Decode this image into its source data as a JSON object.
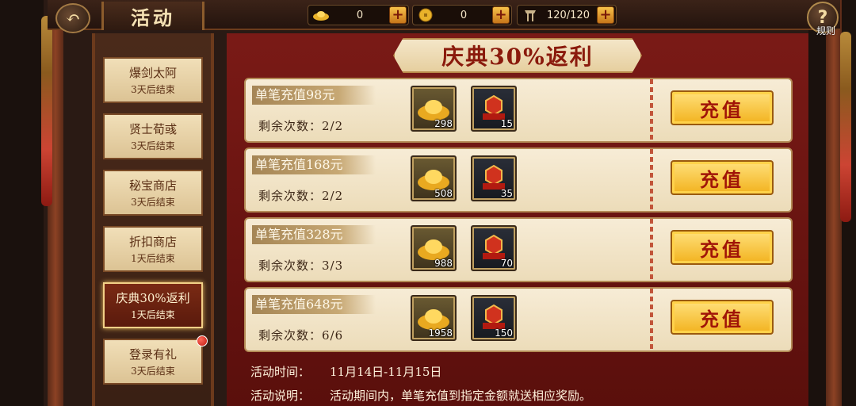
{
  "header": {
    "title": "活动",
    "back_icon": "back-arrow-icon",
    "help_label": "规则",
    "help_symbol": "?"
  },
  "resources": [
    {
      "icon": "gold-ingot-icon",
      "value": "0"
    },
    {
      "icon": "coin-icon",
      "value": "0"
    },
    {
      "icon": "stamina-flag-icon",
      "value": "120/120"
    }
  ],
  "plus_symbol": "+",
  "menu": [
    {
      "name": "爆剑太阿",
      "sub": "3天后结束",
      "active": false,
      "badge": false
    },
    {
      "name": "贤士荀彧",
      "sub": "3天后结束",
      "active": false,
      "badge": false
    },
    {
      "name": "秘宝商店",
      "sub": "3天后结束",
      "active": false,
      "badge": false
    },
    {
      "name": "折扣商店",
      "sub": "1天后结束",
      "active": false,
      "badge": false
    },
    {
      "name": "庆典30%返利",
      "sub": "1天后结束",
      "active": true,
      "badge": false
    },
    {
      "name": "登录有礼",
      "sub": "3天后结束",
      "active": false,
      "badge": true
    }
  ],
  "banner": "庆典30%返利",
  "rewards": [
    {
      "title": "单笔充值98元",
      "remain": "剩余次数：2/2",
      "gold": "298",
      "fire": "15",
      "button": "充值"
    },
    {
      "title": "单笔充值168元",
      "remain": "剩余次数：2/2",
      "gold": "508",
      "fire": "35",
      "button": "充值"
    },
    {
      "title": "单笔充值328元",
      "remain": "剩余次数：3/3",
      "gold": "988",
      "fire": "70",
      "button": "充值"
    },
    {
      "title": "单笔充值648元",
      "remain": "剩余次数：6/6",
      "gold": "1958",
      "fire": "150",
      "button": "充值"
    }
  ],
  "footer": {
    "time_label": "活动时间：",
    "time_value": "11月14日-11月15日",
    "desc_label": "活动说明：",
    "desc_value": "活动期间内，单笔充值到指定金额就送相应奖励。"
  },
  "colors": {
    "panel_red": "#7a1a16",
    "button_gold": "#f2b21e",
    "text_red": "#a01408"
  }
}
